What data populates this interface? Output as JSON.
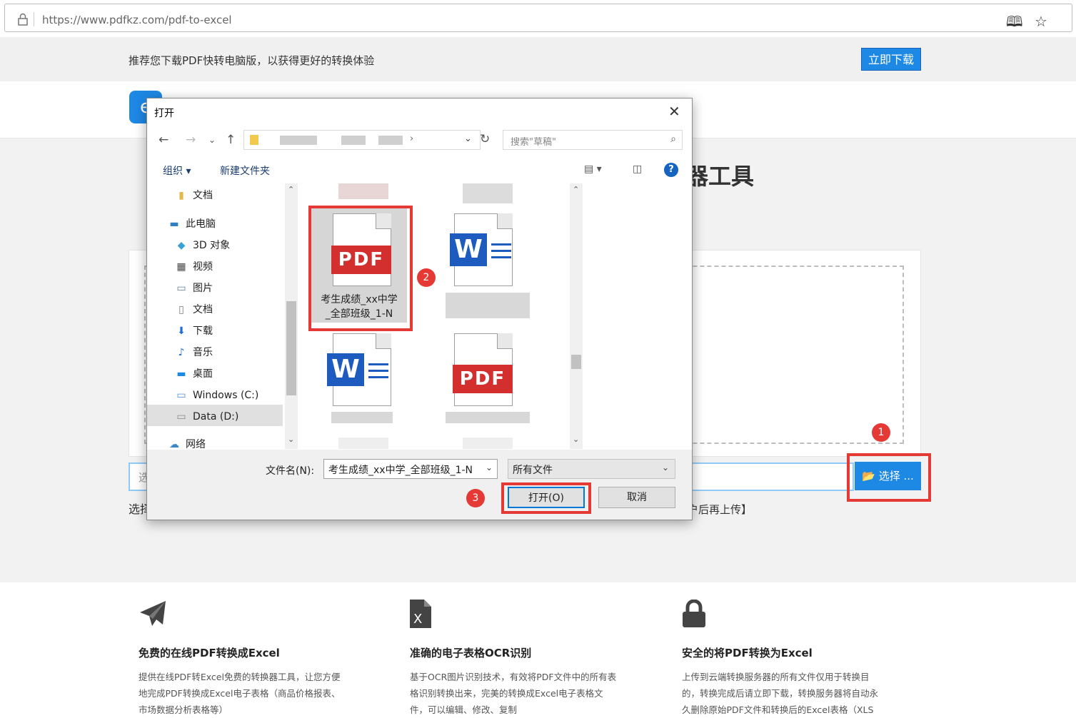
{
  "browser": {
    "url": "https://www.pdfkz.com/pdf-to-excel",
    "reader_icon": "reader-mode-icon",
    "favorite_icon": "star-icon"
  },
  "banner": {
    "message": "推荐您下载PDF快转电脑版，以获得更好的转换体验",
    "download_button": "立即下载"
  },
  "page": {
    "title_fragment": "器工具",
    "select_button": "选择 ...",
    "input_fragment": "选",
    "hint_left": "选择",
    "hint_right": "户后再上传】"
  },
  "annotations": {
    "badge1": "1",
    "badge2": "2",
    "badge3": "3"
  },
  "features": [
    {
      "icon": "paper-plane-icon",
      "title": "免费的在线PDF转换成Excel",
      "desc_lines": [
        "提供在线PDF转Excel免费的转换器工具，让您方便",
        "地完成PDF转换成Excel电子表格（商品价格报表、",
        "市场数据分析表格等）"
      ]
    },
    {
      "icon": "excel-file-icon",
      "title": "准确的电子表格OCR识别",
      "desc_lines": [
        "基于OCR图片识别技术，有效将PDF文件中的所有表",
        "格识别转换出来，完美的转换成Excel电子表格文",
        "件，可以编辑、修改、复制"
      ]
    },
    {
      "icon": "lock-icon",
      "title": "安全的将PDF转换为Excel",
      "desc_lines": [
        "上传到云端转换服务器的所有文件仅用于转换目",
        "的，转换完成后请立即下载，转换服务器将自动永",
        "久删除原始PDF文件和转换后的Excel表格（XLS"
      ]
    }
  ],
  "dialog": {
    "title": "打开",
    "search_placeholder": "搜索\"草稿\"",
    "toolbar": {
      "organize": "组织 ▾",
      "new_folder": "新建文件夹"
    },
    "tree": [
      {
        "label": "文档",
        "icon": "folder-icon"
      },
      {
        "label": "此电脑",
        "icon": "computer-icon"
      },
      {
        "label": "3D 对象",
        "icon": "3d-objects-icon"
      },
      {
        "label": "视频",
        "icon": "video-icon"
      },
      {
        "label": "图片",
        "icon": "pictures-icon"
      },
      {
        "label": "文档",
        "icon": "documents-icon"
      },
      {
        "label": "下载",
        "icon": "download-icon"
      },
      {
        "label": "音乐",
        "icon": "music-icon"
      },
      {
        "label": "桌面",
        "icon": "desktop-icon"
      },
      {
        "label": "Windows (C:)",
        "icon": "drive-icon"
      },
      {
        "label": "Data (D:)",
        "icon": "drive-icon"
      },
      {
        "label": "网络",
        "icon": "network-icon"
      }
    ],
    "selected_file": {
      "type": "PDF",
      "name_line1": "考生成绩_xx中学",
      "name_line2": "_全部班级_1-N"
    },
    "file_type_labels": {
      "pdf": "PDF",
      "word": "W"
    },
    "filename_label": "文件名(N):",
    "filename_value": "考生成绩_xx中学_全部班级_1-N",
    "filetype_value": "所有文件",
    "open_button": "打开(O)",
    "cancel_button": "取消"
  },
  "colors": {
    "accent": "#1e88e5",
    "highlight": "#e53935",
    "pdf_red": "#d32f2f",
    "word_blue": "#1e5bbf"
  }
}
